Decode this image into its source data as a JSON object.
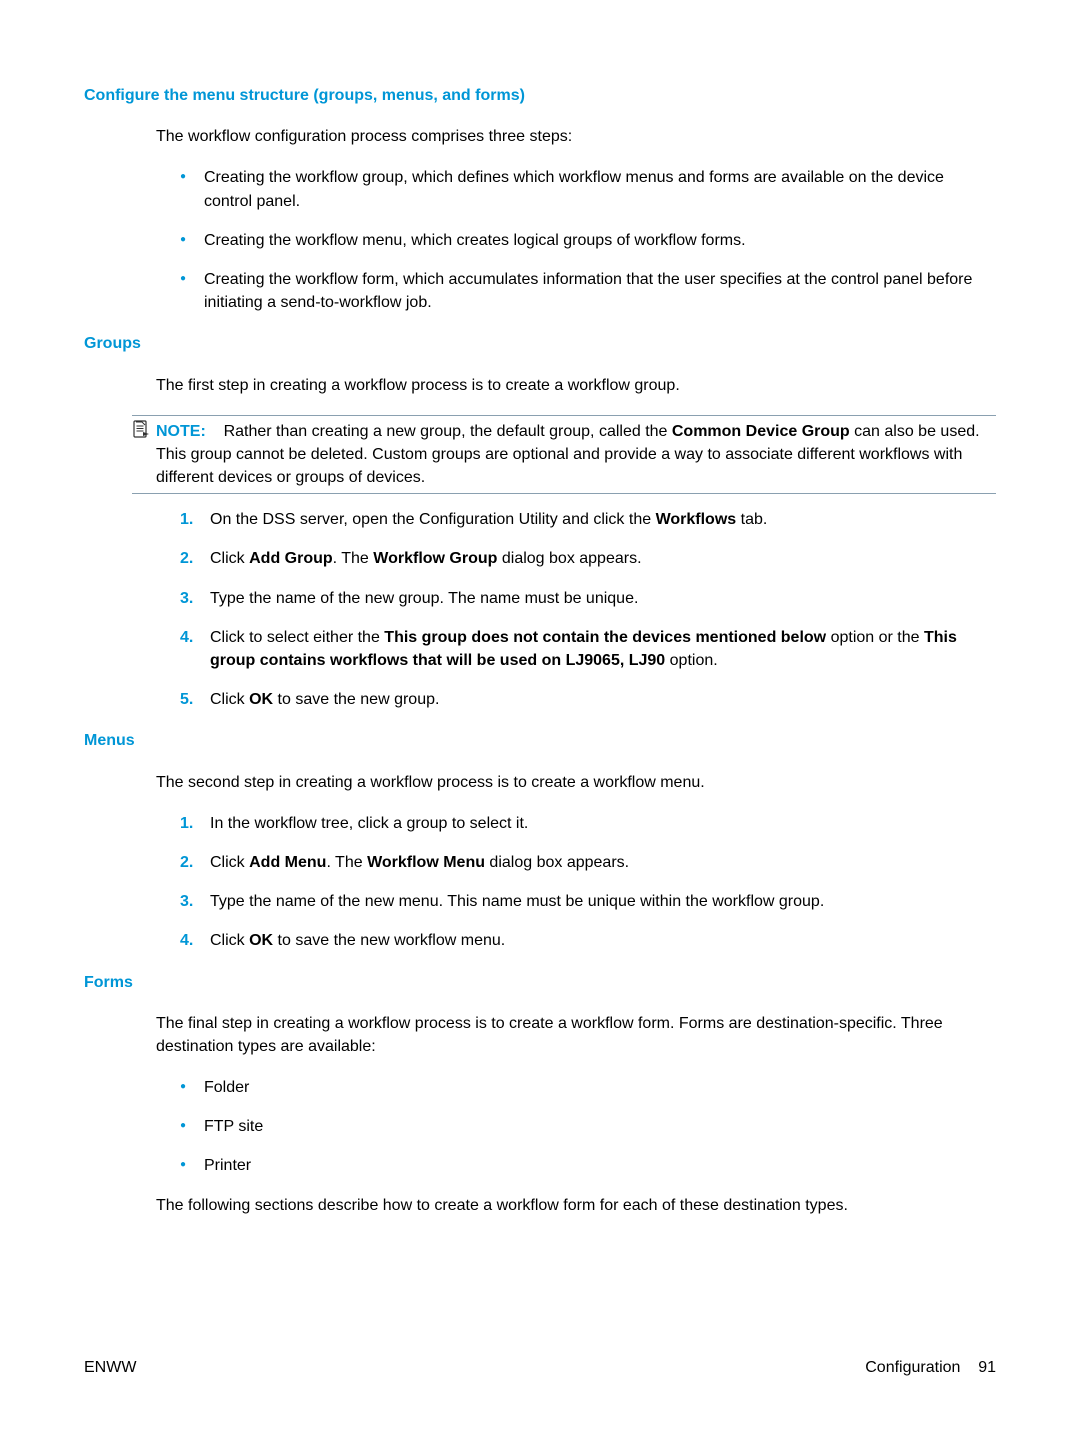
{
  "section1": {
    "heading": "Configure the menu structure (groups, menus, and forms)",
    "intro": "The workflow configuration process comprises three steps:",
    "bullets": [
      "Creating the workflow group, which defines which workflow menus and forms are available on the device control panel.",
      "Creating the workflow menu, which creates logical groups of workflow forms.",
      "Creating the workflow form, which accumulates information that the user specifies at the control panel before initiating a send-to-workflow job."
    ]
  },
  "groups": {
    "heading": "Groups",
    "intro": "The first step in creating a workflow process is to create a workflow group.",
    "note_label": "NOTE:",
    "note_pre": "Rather than creating a new group, the default group, called the ",
    "note_bold": "Common Device Group",
    "note_post": " can also be used. This group cannot be deleted. Custom groups are optional and provide a way to associate different workflows with different devices or groups of devices.",
    "step1_pre": "On the DSS server, open the Configuration Utility and click the ",
    "step1_bold": "Workflows",
    "step1_post": " tab.",
    "step2_a": "Click ",
    "step2_b": "Add Group",
    "step2_c": ". The ",
    "step2_d": "Workflow Group",
    "step2_e": " dialog box appears.",
    "step3": "Type the name of the new group. The name must be unique.",
    "step4_a": "Click to select either the ",
    "step4_b": "This group does not contain the devices mentioned below",
    "step4_c": " option or the ",
    "step4_d": "This group contains workflows that will be used on LJ9065, LJ90",
    "step4_e": " option.",
    "step5_a": "Click ",
    "step5_b": "OK",
    "step5_c": " to save the new group."
  },
  "menus": {
    "heading": "Menus",
    "intro": "The second step in creating a workflow process is to create a workflow menu.",
    "step1": "In the workflow tree, click a group to select it.",
    "step2_a": "Click ",
    "step2_b": "Add Menu",
    "step2_c": ". The ",
    "step2_d": "Workflow Menu",
    "step2_e": " dialog box appears.",
    "step3": "Type the name of the new menu. This name must be unique within the workflow group.",
    "step4_a": "Click ",
    "step4_b": "OK",
    "step4_c": " to save the new workflow menu."
  },
  "forms": {
    "heading": "Forms",
    "intro": "The final step in creating a workflow process is to create a workflow form. Forms are destination-specific. Three destination types are available:",
    "bullets": [
      "Folder",
      "FTP site",
      "Printer"
    ],
    "outro": "The following sections describe how to create a workflow form for each of these destination types."
  },
  "footer": {
    "left": "ENWW",
    "right_label": "Configuration",
    "right_page": "91"
  }
}
